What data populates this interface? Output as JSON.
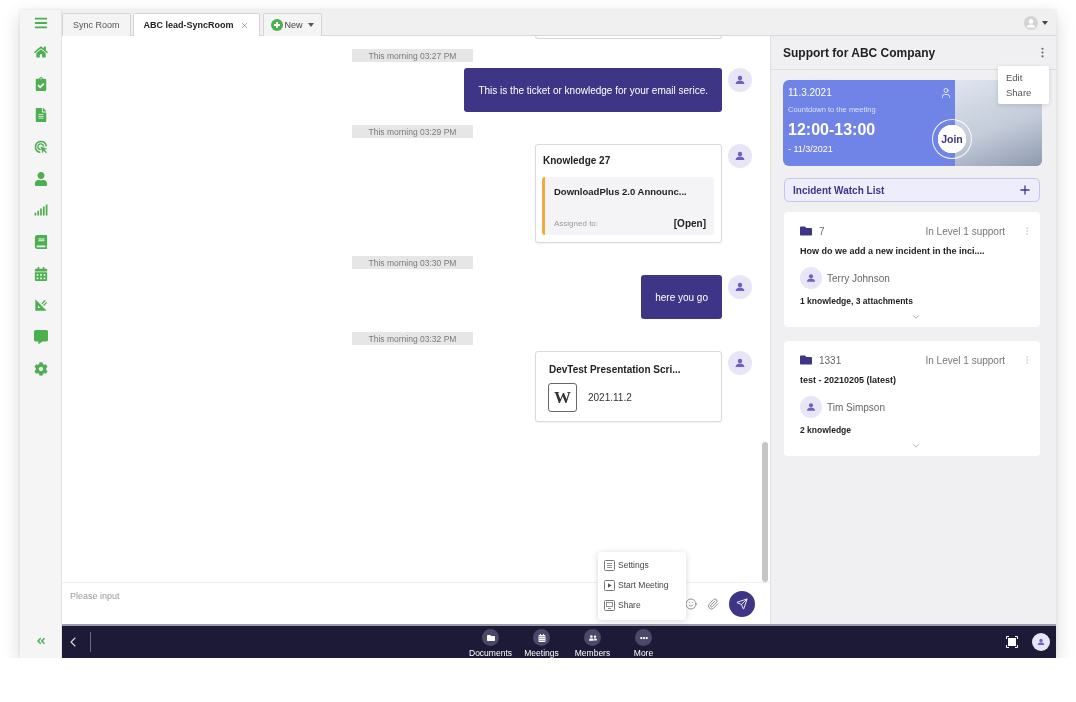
{
  "tabs": [
    {
      "label": "Sync Room",
      "selected": false,
      "closable": false
    },
    {
      "label": "ABC lead-SyncRoom",
      "selected": true,
      "closable": true
    }
  ],
  "new_tab": {
    "label": "New"
  },
  "chat": {
    "messages": [
      {
        "kind": "partial_card"
      },
      {
        "kind": "text",
        "time": "This morning 03:27 PM",
        "text": "This is the ticket or knowledge for your email serice."
      },
      {
        "kind": "knowledge",
        "time": "This morning 03:29 PM",
        "title": "Knowledge 27",
        "item_title": "DownloadPlus 2.0 Announc...",
        "assigned_label": "Assigned to:",
        "status": "[Open]"
      },
      {
        "kind": "text",
        "time": "This morning 03:30 PM",
        "text": "here you go"
      },
      {
        "kind": "file",
        "time": "This morning 03:32 PM",
        "name": "DevTest Presentation Scri...",
        "file_type": "W",
        "date": "2021.11.2"
      }
    ],
    "composer": {
      "placeholder": "Please input"
    },
    "more_menu": [
      "Settings",
      "Start Meeting",
      "Share"
    ]
  },
  "bottom_bar": {
    "items": [
      "Documents",
      "Meetings",
      "Members",
      "More"
    ]
  },
  "support_panel": {
    "title": "Support for ABC Company",
    "menu": [
      "Edit",
      "Share"
    ],
    "meeting": {
      "date": "11.3.2021",
      "caption": "Countdown to the meeting",
      "time": "12:00-13:00",
      "end_date": "- 11/3/2021",
      "join_label": "Join"
    },
    "watch_list": {
      "title": "Incident Watch List"
    },
    "incidents": [
      {
        "number": "7",
        "status": "In Level 1 support",
        "title": "How do we add a new incident in the inci....",
        "assignee": "Terry Johnson",
        "summary": "1 knowledge, 3 attachments"
      },
      {
        "number": "1331",
        "status": "In Level 1 support",
        "title": "test - 20210205 (latest)",
        "assignee": "Tim Simpson",
        "summary": "2 knowledge"
      }
    ]
  }
}
